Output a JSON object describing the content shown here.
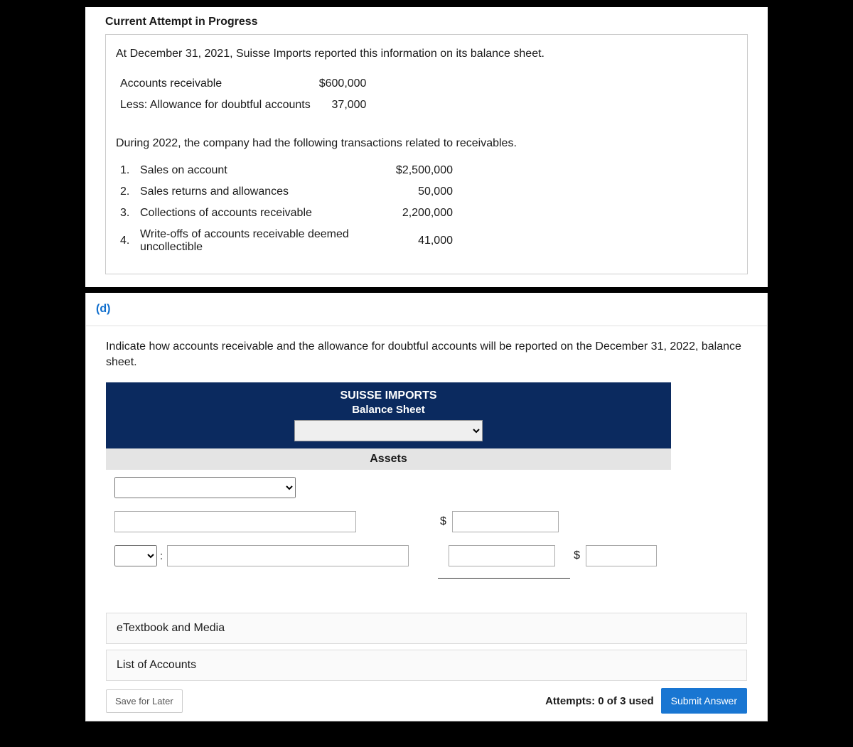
{
  "card1": {
    "attempt_header": "Current Attempt in Progress",
    "intro": "At December 31, 2021, Suisse Imports reported this information on its balance sheet.",
    "balance_rows": [
      {
        "label": "Accounts receivable",
        "value": "$600,000"
      },
      {
        "label": "Less: Allowance for doubtful accounts",
        "value": "37,000"
      }
    ],
    "during": "During 2022, the company had the following transactions related to receivables.",
    "transactions": [
      {
        "n": "1.",
        "desc": "Sales on account",
        "amt": "$2,500,000"
      },
      {
        "n": "2.",
        "desc": "Sales returns and allowances",
        "amt": "50,000"
      },
      {
        "n": "3.",
        "desc": "Collections of accounts receivable",
        "amt": "2,200,000"
      },
      {
        "n": "4.",
        "desc": "Write-offs of accounts receivable deemed uncollectible",
        "amt": "41,000"
      }
    ]
  },
  "card2": {
    "part_label": "(d)",
    "instruct": "Indicate how accounts receivable and the allowance for doubtful accounts will be reported on the December 31, 2022, balance sheet.",
    "sheet": {
      "company": "SUISSE IMPORTS",
      "title": "Balance Sheet",
      "assets_label": "Assets"
    },
    "links": {
      "etext": "eTextbook and Media",
      "loa": "List of Accounts"
    },
    "footer": {
      "save": "Save for Later",
      "attempts": "Attempts: 0 of 3 used",
      "submit": "Submit Answer"
    }
  }
}
